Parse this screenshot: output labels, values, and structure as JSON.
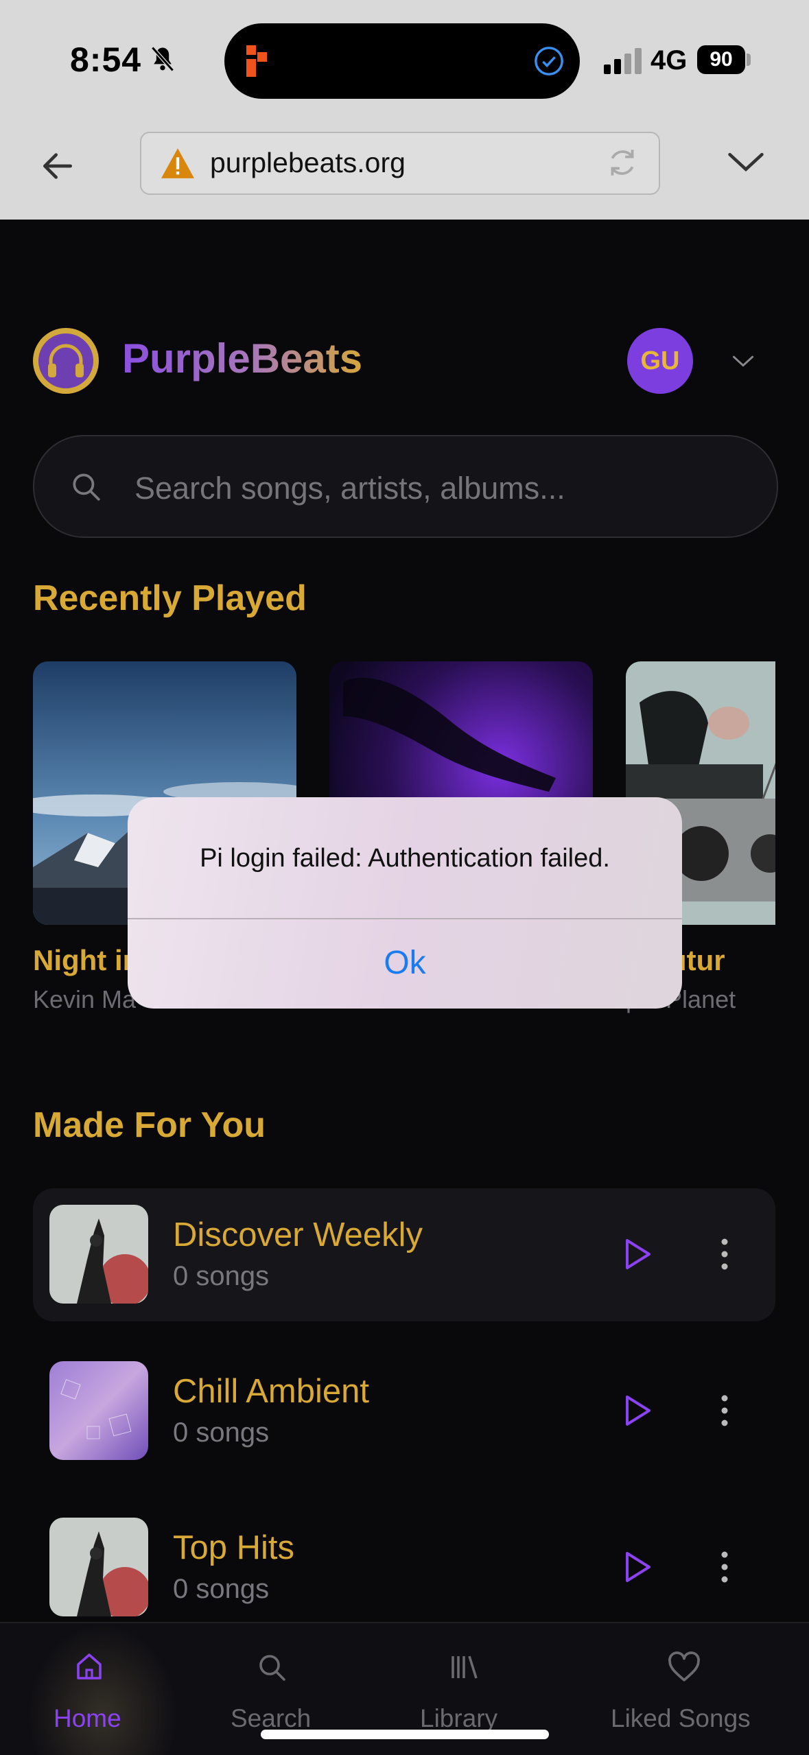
{
  "status_bar": {
    "time": "8:54",
    "network": "4G",
    "battery": "90"
  },
  "browser": {
    "url": "purplebeats.org"
  },
  "header": {
    "brand": "PurpleBeats",
    "avatar_initials": "GU"
  },
  "search": {
    "placeholder": "Search songs, artists, albums..."
  },
  "recently_played": {
    "title": "Recently Played",
    "cards": [
      {
        "title": "Night in",
        "artist": "Kevin Ma"
      },
      {
        "title": "",
        "artist": ""
      },
      {
        "title": "o Futur",
        "artist": "ple Planet"
      }
    ]
  },
  "made_for_you": {
    "title": "Made For You",
    "playlists": [
      {
        "title": "Discover Weekly",
        "count": "0 songs"
      },
      {
        "title": "Chill Ambient",
        "count": "0 songs"
      },
      {
        "title": "Top Hits",
        "count": "0 songs"
      }
    ]
  },
  "nav": {
    "items": [
      {
        "label": "Home",
        "active": true
      },
      {
        "label": "Search",
        "active": false
      },
      {
        "label": "Library",
        "active": false
      },
      {
        "label": "Liked Songs",
        "active": false
      }
    ]
  },
  "dialog": {
    "message": "Pi login failed: Authentication failed.",
    "ok_label": "Ok"
  },
  "colors": {
    "accent_purple": "#7d3ee0",
    "accent_gold": "#d9a936",
    "link_blue": "#1a7cf0"
  },
  "icons": [
    "bell-slash-icon",
    "app-icon",
    "check-circle-icon",
    "signal-icon",
    "back-arrow-icon",
    "warning-icon",
    "reload-icon",
    "chevron-down-icon",
    "headphones-icon",
    "search-icon",
    "play-icon",
    "more-vertical-icon",
    "home-icon",
    "library-icon",
    "heart-icon"
  ]
}
